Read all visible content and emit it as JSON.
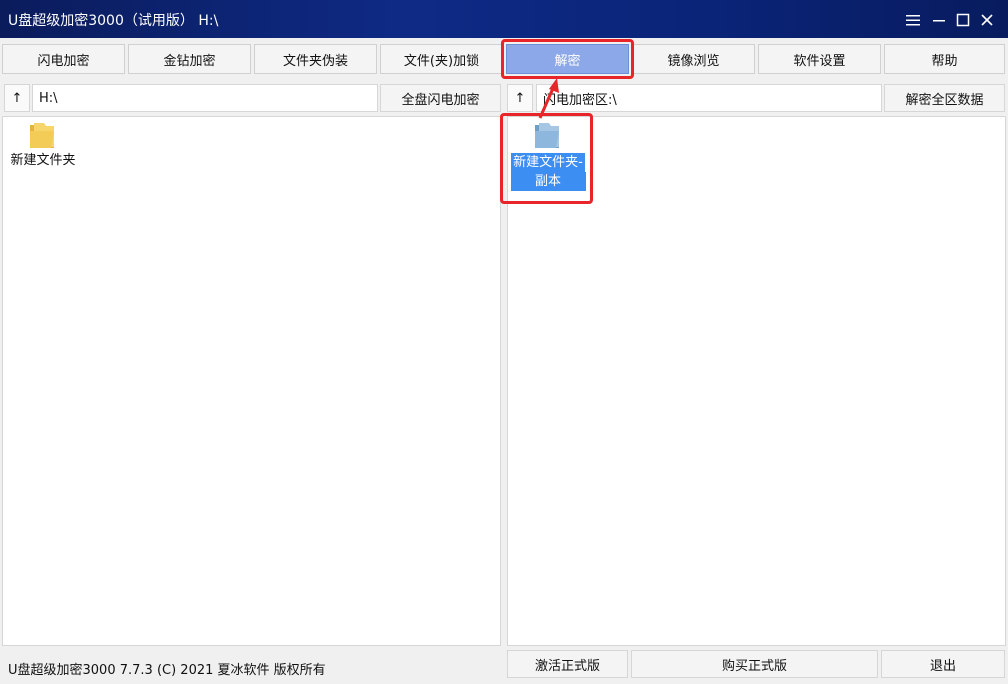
{
  "window": {
    "title": "U盘超级加密3000（试用版） H:\\",
    "controls": [
      "menu-icon",
      "minimize-icon",
      "maximize-icon",
      "close-icon"
    ]
  },
  "toolbar": {
    "flash_encrypt": "闪电加密",
    "gold_encrypt": "金钻加密",
    "folder_disguise": "文件夹伪装",
    "file_lock": "文件(夹)加锁",
    "decrypt": "解密",
    "mirror_browse": "镜像浏览",
    "settings": "软件设置",
    "help": "帮助"
  },
  "left_pane": {
    "up_icon": "↑",
    "path": "H:\\",
    "action": "全盘闪电加密",
    "files": [
      {
        "name": "新建文件夹",
        "icon": "folder-icon"
      }
    ]
  },
  "right_pane": {
    "up_icon": "↑",
    "path": "闪电加密区:\\",
    "action": "解密全区数据",
    "files": [
      {
        "line1": "新建文件夹-",
        "line2": "副本",
        "icon": "encrypted-folder-icon",
        "selected": true
      }
    ]
  },
  "footer": {
    "status": "U盘超级加密3000 7.7.3 (C) 2021 夏冰软件 版权所有",
    "activate": "激活正式版",
    "buy": "购买正式版",
    "exit": "退出"
  },
  "colors": {
    "accent_active": "#8ca8e8",
    "highlight_red": "#e8262a",
    "selection": "#3d8ef2"
  }
}
